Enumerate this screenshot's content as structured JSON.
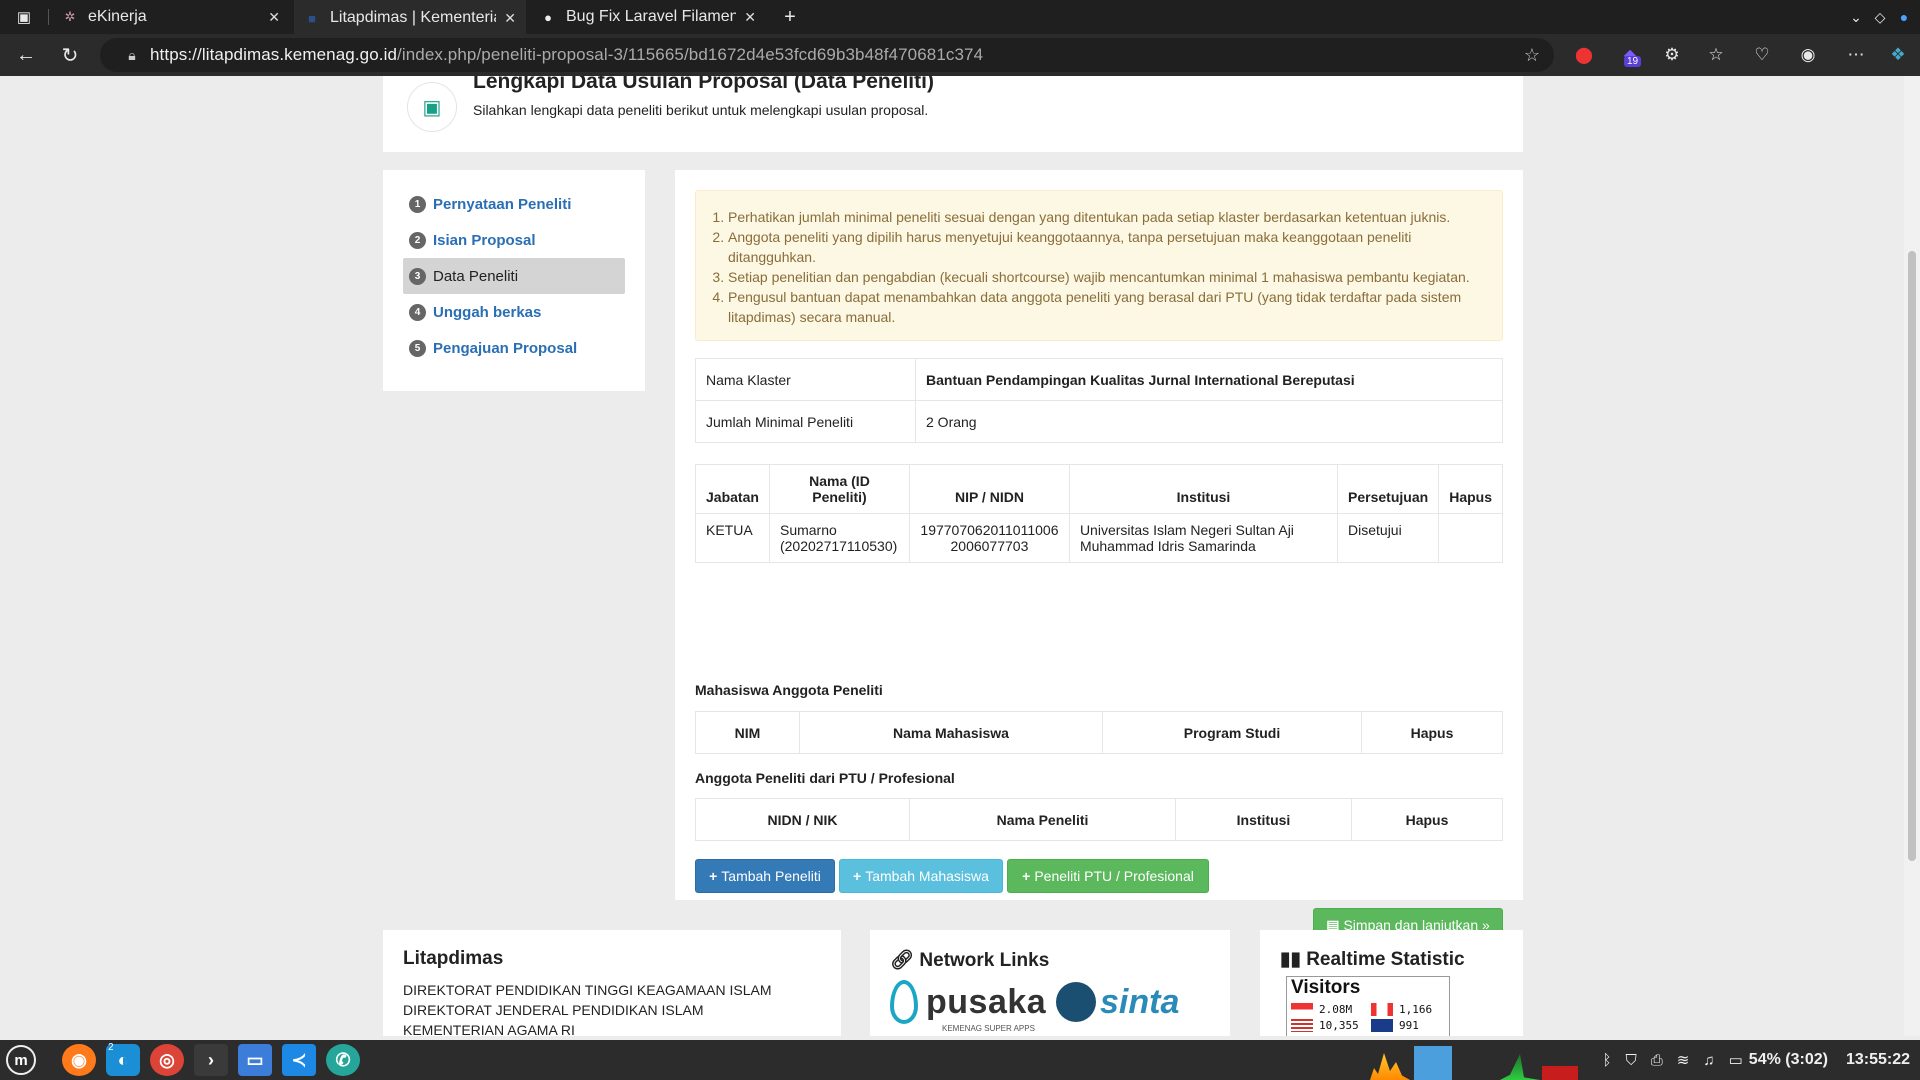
{
  "browser": {
    "tabs": [
      {
        "label": "eKinerja",
        "icon": "ekinerja-favicon"
      },
      {
        "label": "Litapdimas | Kementeria",
        "icon": "litapdimas-favicon"
      },
      {
        "label": "Bug Fix Laravel Filament",
        "icon": "github-favicon"
      }
    ],
    "url_host": "https://litapdimas.kemenag.go.id",
    "url_path": "/index.php/peneliti-proposal-3/115665/bd1672d4e53fcd69b3b48f470681c374",
    "badge_count": "19"
  },
  "header": {
    "title": "Lengkapi Data Usulan Proposal (Data Peneliti)",
    "subtitle": "Silahkan lengkapi data peneliti berikut untuk melengkapi usulan proposal."
  },
  "steps": [
    {
      "num": "1",
      "label": "Pernyataan Peneliti"
    },
    {
      "num": "2",
      "label": "Isian Proposal"
    },
    {
      "num": "3",
      "label": "Data Peneliti"
    },
    {
      "num": "4",
      "label": "Unggah berkas"
    },
    {
      "num": "5",
      "label": "Pengajuan Proposal"
    }
  ],
  "notice": [
    "Perhatikan jumlah minimal peneliti sesuai dengan yang ditentukan pada setiap klaster berdasarkan ketentuan juknis.",
    "Anggota peneliti yang dipilih harus menyetujui keanggotaannya, tanpa persetujuan maka keanggotaan peneliti ditangguhkan.",
    "Setiap penelitian dan pengabdian (kecuali shortcourse) wajib mencantumkan minimal 1 mahasiswa pembantu kegiatan.",
    "Pengusul bantuan dapat menambahkan data anggota peneliti yang berasal dari PTU (yang tidak terdaftar pada sistem litapdimas) secara manual."
  ],
  "info": {
    "klaster_label": "Nama Klaster",
    "klaster_value": "Bantuan Pendampingan Kualitas Jurnal International Bereputasi",
    "jumlah_label": "Jumlah Minimal Peneliti",
    "jumlah_value": "2 Orang"
  },
  "peneliti_table": {
    "headers": [
      "Jabatan",
      "Nama (ID Peneliti)",
      "NIP / NIDN",
      "Institusi",
      "Persetujuan",
      "Hapus"
    ],
    "rows": [
      {
        "jabatan": "KETUA",
        "nama": "Sumarno (20202717110530)",
        "nip": "197707062011011006",
        "nidn": "2006077703",
        "institusi": "Universitas Islam Negeri Sultan Aji Muhammad Idris Samarinda",
        "persetujuan": "Disetujui",
        "hapus": ""
      }
    ]
  },
  "mahasiswa": {
    "title": "Mahasiswa Anggota Peneliti",
    "headers": [
      "NIM",
      "Nama Mahasiswa",
      "Program Studi",
      "Hapus"
    ]
  },
  "ptu": {
    "title": "Anggota Peneliti dari PTU / Profesional",
    "headers": [
      "NIDN / NIK",
      "Nama Peneliti",
      "Institusi",
      "Hapus"
    ]
  },
  "buttons": {
    "tambah_peneliti": "Tambah Peneliti",
    "tambah_mahasiswa": "Tambah Mahasiswa",
    "peneliti_ptu": "Peneliti PTU / Profesional",
    "simpan": "Simpan dan lanjutkan »"
  },
  "footer": {
    "litapdimas_title": "Litapdimas",
    "litapdimas_lines": [
      "DIREKTORAT PENDIDIKAN TINGGI KEAGAMAAN ISLAM",
      "DIREKTORAT JENDERAL PENDIDIKAN ISLAM",
      "KEMENTERIAN AGAMA RI"
    ],
    "links_title": "Network Links",
    "pusaka_word": "pusaka",
    "pusaka_sub": "KEMENAG SUPER APPS",
    "sinta_word": "sinta",
    "stat_title": "Realtime Statistic",
    "visitors_title": "Visitors",
    "visitor_counts": [
      "2.08M",
      "1,166",
      "10,355",
      "991"
    ]
  },
  "taskbar": {
    "workspace_badge": "2",
    "battery": "54% (3:02)",
    "clock": "13:55:22"
  },
  "colors": {
    "primary": "#337ab7",
    "info": "#5bc0de",
    "success": "#5cb85c",
    "alert_bg": "#fcf8e3",
    "alert_text": "#8a6d3b",
    "step_link": "#2a6fb5"
  }
}
